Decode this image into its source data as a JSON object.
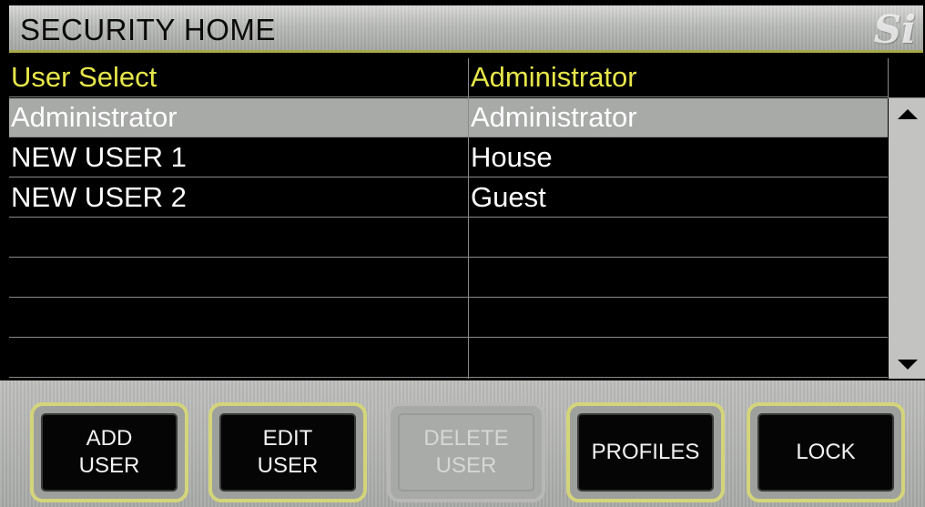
{
  "header": {
    "title": "SECURITY HOME",
    "logo_text": "Si"
  },
  "table": {
    "columns": [
      "User Select",
      "Administrator"
    ],
    "rows": [
      {
        "user": "Administrator",
        "profile": "Administrator",
        "selected": true
      },
      {
        "user": "NEW USER 1",
        "profile": "House",
        "selected": false
      },
      {
        "user": "NEW USER 2",
        "profile": "Guest",
        "selected": false
      },
      {
        "user": "",
        "profile": "",
        "selected": false
      },
      {
        "user": "",
        "profile": "",
        "selected": false
      },
      {
        "user": "",
        "profile": "",
        "selected": false
      },
      {
        "user": "",
        "profile": "",
        "selected": false
      }
    ]
  },
  "scrollbar": {
    "up_icon": "arrow-up-icon",
    "down_icon": "arrow-down-icon"
  },
  "toolbar": {
    "add_user": {
      "line1": "ADD",
      "line2": "USER"
    },
    "edit_user": {
      "line1": "EDIT",
      "line2": "USER"
    },
    "delete_user": {
      "line1": "DELETE",
      "line2": "USER",
      "disabled": true
    },
    "profiles": {
      "label": "PROFILES"
    },
    "lock": {
      "label": "LOCK"
    }
  },
  "colors": {
    "header_text": "#e6e64a",
    "selected_row": "#a8aaa8",
    "button_border": "#d4d57a"
  }
}
